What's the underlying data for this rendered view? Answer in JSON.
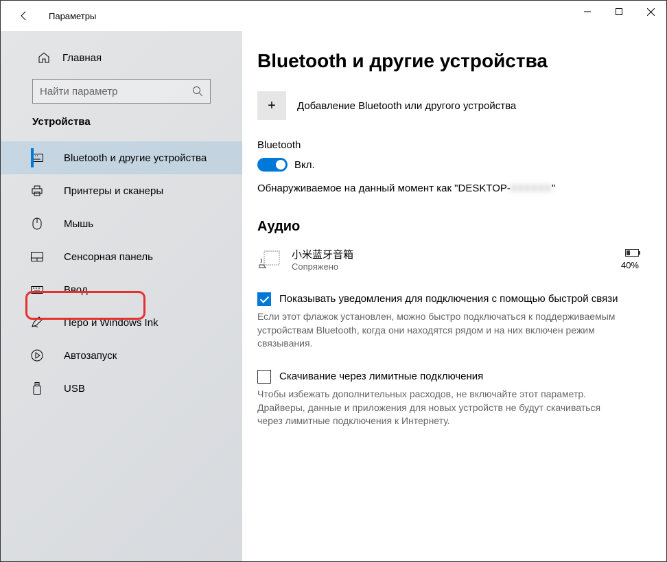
{
  "window": {
    "title": "Параметры"
  },
  "home_label": "Главная",
  "search": {
    "placeholder": "Найти параметр"
  },
  "section_title": "Устройства",
  "nav": {
    "bluetooth": "Bluetooth и другие устройства",
    "printers": "Принтеры и сканеры",
    "mouse": "Мышь",
    "touchpad": "Сенсорная панель",
    "typing": "Ввод",
    "pen": "Перо и Windows Ink",
    "autoplay": "Автозапуск",
    "usb": "USB"
  },
  "main": {
    "title": "Bluetooth и другие устройства",
    "add_device": "Добавление Bluetooth или другого устройства",
    "bt_label": "Bluetooth",
    "bt_state": "Вкл.",
    "discoverable_prefix": "Обнаруживаемое на данный момент как \"DESKTOP-",
    "discoverable_blur": "XXXXXX",
    "discoverable_suffix": "\"",
    "audio_head": "Аудио",
    "device": {
      "name": "小米蓝牙音箱",
      "status": "Сопряжено",
      "battery": "40%"
    },
    "swift_pair": {
      "label": "Показывать уведомления для подключения с помощью быстрой связи",
      "desc": "Если этот флажок установлен, можно быстро подключаться к поддерживаемым устройствам Bluetooth, когда они находятся рядом и на них включен режим связывания."
    },
    "metered": {
      "label": "Скачивание через лимитные подключения",
      "desc": "Чтобы избежать дополнительных расходов, не включайте этот параметр. Драйверы, данные и приложения для новых устройств не будут скачиваться через лимитные подключения к Интернету."
    }
  }
}
